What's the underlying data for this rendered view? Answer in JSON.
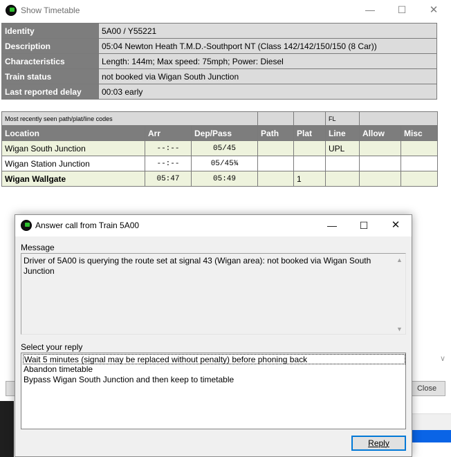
{
  "timetable_window": {
    "title": "Show Timetable",
    "info": [
      {
        "label": "Identity",
        "value": "5A00 / Y55221"
      },
      {
        "label": "Description",
        "value": "05:04 Newton Heath T.M.D.-Southport NT (Class 142/142/150/150 (8 Car))"
      },
      {
        "label": "Characteristics",
        "value": "Length: 144m; Max speed: 75mph; Power: Diesel"
      },
      {
        "label": "Train status",
        "value": "not booked via Wigan South Junction"
      },
      {
        "label": "Last reported delay",
        "value": "00:03 early"
      }
    ],
    "path_table": {
      "top_caption": "Most recently seen path/plat/line codes",
      "top_fl": "FL",
      "headers": [
        "Location",
        "Arr",
        "Dep/Pass",
        "Path",
        "Plat",
        "Line",
        "Allow",
        "Misc"
      ],
      "rows": [
        {
          "location": "Wigan South Junction",
          "arr": "--:--",
          "dep": "05/45",
          "path": "",
          "plat": "",
          "line": "UPL",
          "allow": "",
          "misc": ""
        },
        {
          "location": "Wigan Station Junction",
          "arr": "--:--",
          "dep": "05/45¾",
          "path": "",
          "plat": "",
          "line": "",
          "allow": "",
          "misc": ""
        },
        {
          "location": "Wigan Wallgate",
          "arr": "05:47",
          "dep": "05:49",
          "path": "",
          "plat": "1",
          "line": "",
          "allow": "",
          "misc": ""
        }
      ]
    },
    "close_button_label": "Close"
  },
  "dialog": {
    "title": "Answer call from Train 5A00",
    "message_label": "Message",
    "message_text": "Driver of 5A00 is querying the route set at signal 43 (Wigan area): not booked via Wigan South Junction",
    "reply_label": "Select your reply",
    "replies": [
      "Wait 5 minutes (signal may be replaced without penalty) before phoning back",
      "Abandon timetable",
      "Bypass Wigan South Junction and then keep to timetable"
    ],
    "selected_reply_index": 0,
    "reply_button_label": "Reply"
  },
  "icons": {
    "app": "train-app-icon",
    "minimize": "minimize-icon",
    "maximize": "maximize-icon",
    "close": "close-icon"
  },
  "colors": {
    "header_gray": "#7d7d7d",
    "value_gray": "#dcdcdc",
    "row_tint": "#eef3dd",
    "focus_blue": "#0078d7"
  }
}
